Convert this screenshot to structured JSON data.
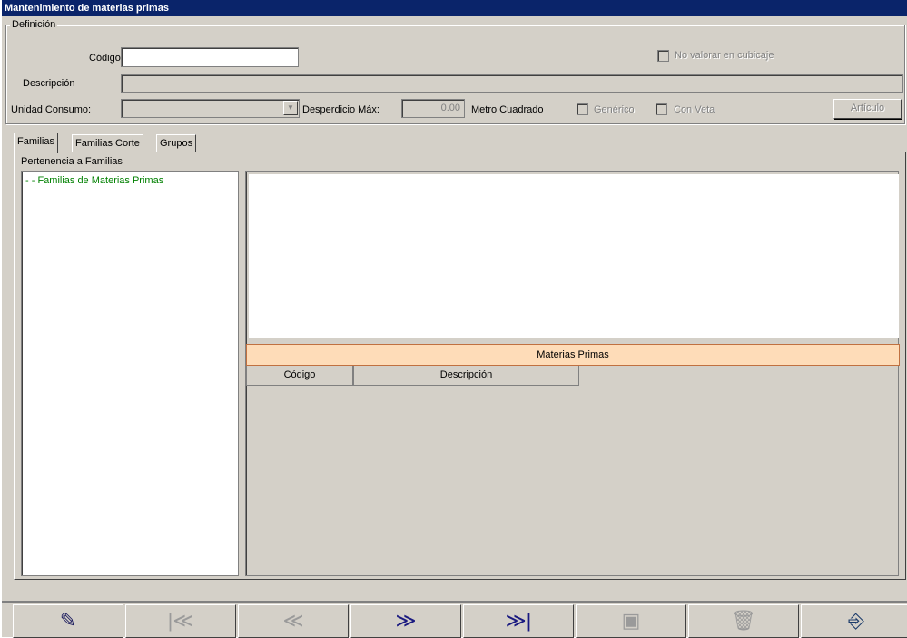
{
  "window": {
    "title": "Mantenimiento de materias primas"
  },
  "definition": {
    "group_label": "Definición",
    "codigo_label": "Código:",
    "codigo_value": "",
    "descripcion_label": "Descripción",
    "descripcion_value": "",
    "unidad_label": "Unidad Consumo:",
    "unidad_value": "",
    "desperdicio_label": "Desperdicio Máx:",
    "desperdicio_value": "0.00",
    "metro_cuadrado_label": "Metro Cuadrado",
    "generico_label": "Genérico",
    "con_veta_label": "Con Veta",
    "no_valorar_label": "No valorar en cubicaje",
    "articulo_button": "Artículo"
  },
  "tabs": [
    {
      "label": "Familias",
      "active": true
    },
    {
      "label": "Familias Corte",
      "active": false
    },
    {
      "label": "Grupos",
      "active": false
    }
  ],
  "familias": {
    "group_label": "Pertenencia a Familias",
    "tree_root": "- - Familias de Materias Primas"
  },
  "grid": {
    "caption": "Materias Primas",
    "columns": [
      "Código",
      "Descripción"
    ],
    "rows": []
  },
  "toolbar": [
    {
      "name": "edit-button",
      "icon": "pencil-icon",
      "glyph": "✎",
      "color": "#202060",
      "enabled": true
    },
    {
      "name": "first-record-button",
      "icon": "first-icon",
      "glyph": "|≪",
      "color": "#9a9a9a",
      "enabled": false
    },
    {
      "name": "previous-record-button",
      "icon": "previous-icon",
      "glyph": "≪",
      "color": "#9a9a9a",
      "enabled": false
    },
    {
      "name": "next-record-button",
      "icon": "next-icon",
      "glyph": "≫",
      "color": "#1a1a80",
      "enabled": true
    },
    {
      "name": "last-record-button",
      "icon": "last-icon",
      "glyph": "≫|",
      "color": "#1a1a80",
      "enabled": true
    },
    {
      "name": "save-button",
      "icon": "floppy-icon",
      "glyph": "▣",
      "color": "#9a9a9a",
      "enabled": false
    },
    {
      "name": "delete-button",
      "icon": "trash-icon",
      "glyph": "🗑",
      "color": "#9a9a9a",
      "enabled": false
    },
    {
      "name": "exit-button",
      "icon": "exit-door-icon",
      "glyph": "⎆",
      "color": "#1a3a6a",
      "enabled": true
    }
  ]
}
